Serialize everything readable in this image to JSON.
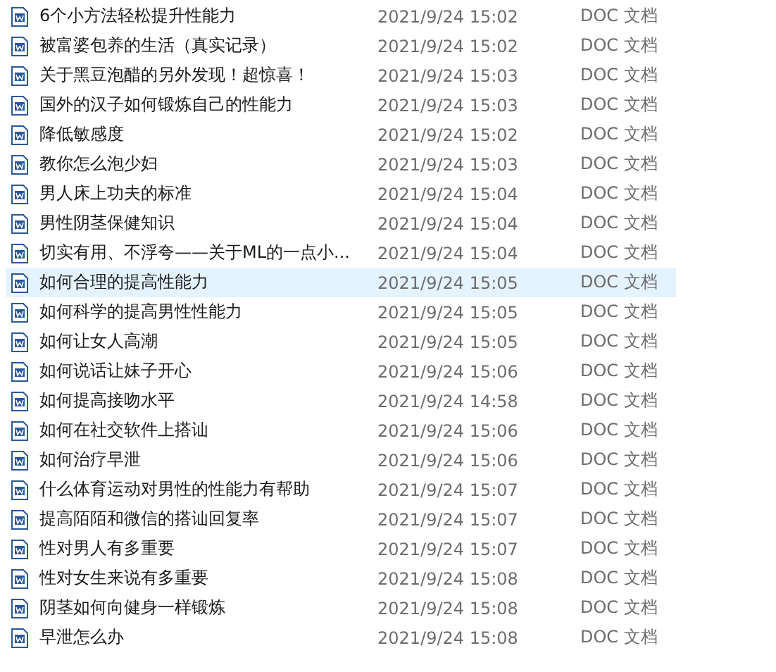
{
  "files": [
    {
      "name": "6个小方法轻松提升性能力",
      "modified": "2021/9/24 15:02",
      "type": "DOC 文档",
      "selected": false
    },
    {
      "name": "被富婆包养的生活（真实记录）",
      "modified": "2021/9/24 15:02",
      "type": "DOC 文档",
      "selected": false
    },
    {
      "name": "关于黑豆泡醋的另外发现！超惊喜！",
      "modified": "2021/9/24 15:03",
      "type": "DOC 文档",
      "selected": false
    },
    {
      "name": "国外的汉子如何锻炼自己的性能力",
      "modified": "2021/9/24 15:03",
      "type": "DOC 文档",
      "selected": false
    },
    {
      "name": "降低敏感度",
      "modified": "2021/9/24 15:02",
      "type": "DOC 文档",
      "selected": false
    },
    {
      "name": "教你怎么泡少妇",
      "modified": "2021/9/24 15:03",
      "type": "DOC 文档",
      "selected": false
    },
    {
      "name": "男人床上功夫的标准",
      "modified": "2021/9/24 15:04",
      "type": "DOC 文档",
      "selected": false
    },
    {
      "name": "男性阴茎保健知识",
      "modified": "2021/9/24 15:04",
      "type": "DOC 文档",
      "selected": false
    },
    {
      "name": "切实有用、不浮夸——关于ML的一点小...",
      "modified": "2021/9/24 15:04",
      "type": "DOC 文档",
      "selected": false
    },
    {
      "name": "如何合理的提高性能力",
      "modified": "2021/9/24 15:05",
      "type": "DOC 文档",
      "selected": true
    },
    {
      "name": "如何科学的提高男性性能力",
      "modified": "2021/9/24 15:05",
      "type": "DOC 文档",
      "selected": false
    },
    {
      "name": "如何让女人高潮",
      "modified": "2021/9/24 15:05",
      "type": "DOC 文档",
      "selected": false
    },
    {
      "name": "如何说话让妹子开心",
      "modified": "2021/9/24 15:06",
      "type": "DOC 文档",
      "selected": false
    },
    {
      "name": "如何提高接吻水平",
      "modified": "2021/9/24 14:58",
      "type": "DOC 文档",
      "selected": false
    },
    {
      "name": "如何在社交软件上搭讪",
      "modified": "2021/9/24 15:06",
      "type": "DOC 文档",
      "selected": false
    },
    {
      "name": "如何治疗早泄",
      "modified": "2021/9/24 15:06",
      "type": "DOC 文档",
      "selected": false
    },
    {
      "name": "什么体育运动对男性的性能力有帮助",
      "modified": "2021/9/24 15:07",
      "type": "DOC 文档",
      "selected": false
    },
    {
      "name": "提高陌陌和微信的搭讪回复率",
      "modified": "2021/9/24 15:07",
      "type": "DOC 文档",
      "selected": false
    },
    {
      "name": "性对男人有多重要",
      "modified": "2021/9/24 15:07",
      "type": "DOC 文档",
      "selected": false
    },
    {
      "name": "性对女生来说有多重要",
      "modified": "2021/9/24 15:08",
      "type": "DOC 文档",
      "selected": false
    },
    {
      "name": "阴茎如何向健身一样锻炼",
      "modified": "2021/9/24 15:08",
      "type": "DOC 文档",
      "selected": false
    },
    {
      "name": "早泄怎么办",
      "modified": "2021/9/24 15:08",
      "type": "DOC 文档",
      "selected": false
    }
  ]
}
